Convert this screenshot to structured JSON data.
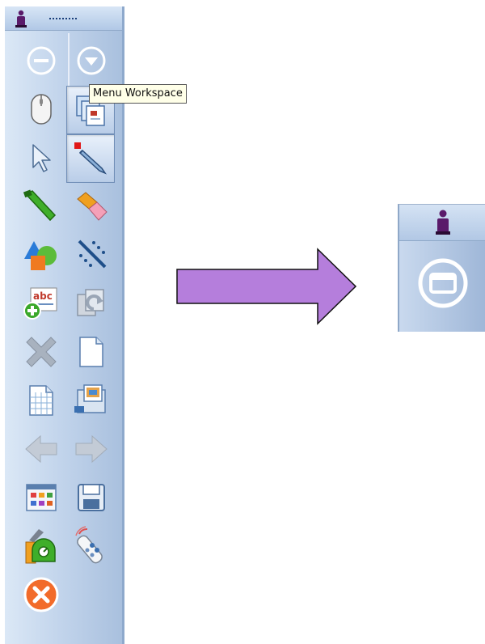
{
  "toolbar": {
    "grip_icon": "grip-dots-icon",
    "logo_icon": "interactive-logo-icon",
    "buttons": [
      {
        "id": "minimize",
        "icon": "minimize-circle-icon"
      },
      {
        "id": "menu",
        "icon": "dropdown-circle-icon"
      },
      {
        "id": "mouse",
        "icon": "mouse-icon"
      },
      {
        "id": "menu-workspace",
        "icon": "stacked-pages-icon",
        "pressed": true
      },
      {
        "id": "select",
        "icon": "arrow-pointer-icon"
      },
      {
        "id": "pen",
        "icon": "pen-icon",
        "pressed": true
      },
      {
        "id": "highlighter",
        "icon": "highlighter-icon"
      },
      {
        "id": "eraser",
        "icon": "eraser-icon"
      },
      {
        "id": "shapes",
        "icon": "shapes-icon"
      },
      {
        "id": "magic-line",
        "icon": "dotted-line-icon"
      },
      {
        "id": "add-text",
        "icon": "add-text-abc-icon"
      },
      {
        "id": "undo",
        "icon": "undo-page-icon"
      },
      {
        "id": "delete",
        "icon": "delete-x-icon"
      },
      {
        "id": "new-page",
        "icon": "blank-page-icon"
      },
      {
        "id": "grid-page",
        "icon": "grid-page-icon"
      },
      {
        "id": "screen-capture",
        "icon": "screen-capture-icon"
      },
      {
        "id": "back",
        "icon": "arrow-left-icon"
      },
      {
        "id": "forward",
        "icon": "arrow-right-icon"
      },
      {
        "id": "gallery",
        "icon": "gallery-icon"
      },
      {
        "id": "save",
        "icon": "floppy-disk-icon"
      },
      {
        "id": "tools",
        "icon": "tools-kit-icon"
      },
      {
        "id": "remote",
        "icon": "remote-control-icon"
      },
      {
        "id": "close",
        "icon": "close-circle-icon"
      }
    ]
  },
  "tooltip": {
    "text": "Menu Workspace"
  },
  "transition_arrow": {
    "color": "#b57edc",
    "icon": "right-arrow-icon"
  },
  "collapsed_toolbar": {
    "logo_icon": "interactive-logo-icon",
    "button_icon": "restore-circle-icon"
  },
  "colors": {
    "toolbar_light": "#dbe8f6",
    "toolbar_dark": "#a9c0de",
    "tooltip_bg": "#ffffe8",
    "close_orange": "#f26b2a"
  }
}
